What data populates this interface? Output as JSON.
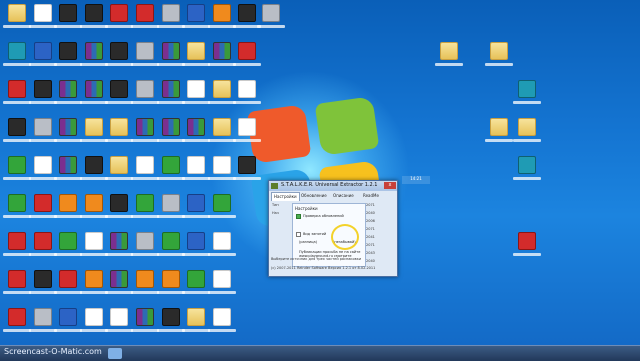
{
  "desktop": {
    "wallpaper": "windows-7-default",
    "accent": "#1474d1",
    "icon_rows": [
      [
        "folder",
        "doc",
        "dark",
        "dark",
        "red",
        "red",
        "grey",
        "blue",
        "orange",
        "dark",
        "grey",
        "",
        "",
        "",
        "",
        "",
        "",
        "",
        "",
        ""
      ],
      [
        "teal",
        "blue",
        "dark",
        "rar",
        "dark",
        "grey",
        "rar",
        "folder",
        "rar",
        "red",
        "",
        "",
        "",
        "",
        "",
        "",
        "folder",
        "folder",
        "",
        ""
      ],
      [
        "red",
        "dark",
        "rar",
        "rar",
        "dark",
        "grey",
        "rar",
        "doc",
        "folder",
        "doc",
        "",
        "",
        "",
        "",
        "",
        "",
        "",
        "",
        "teal",
        ""
      ],
      [
        "dark",
        "grey",
        "rar",
        "folder",
        "folder",
        "rar",
        "rar",
        "rar",
        "folder",
        "doc",
        "",
        "",
        "",
        "",
        "",
        "",
        "",
        "folder",
        "folder",
        ""
      ],
      [
        "green",
        "doc",
        "rar",
        "dark",
        "folder",
        "doc",
        "green",
        "doc",
        "doc",
        "dark",
        "",
        "",
        "",
        "",
        "",
        "",
        "",
        "",
        "teal",
        ""
      ],
      [
        "green",
        "red",
        "orange",
        "orange",
        "dark",
        "green",
        "grey",
        "blue",
        "green",
        "",
        "",
        "",
        "",
        "",
        "",
        "",
        "",
        "",
        "",
        ""
      ],
      [
        "red",
        "red",
        "green",
        "doc",
        "rar",
        "grey",
        "green",
        "blue",
        "doc",
        "",
        "",
        "",
        "",
        "",
        "",
        "",
        "",
        "",
        "red",
        ""
      ],
      [
        "red",
        "dark",
        "red",
        "orange",
        "rar",
        "orange",
        "orange",
        "green",
        "doc",
        "",
        "",
        "",
        "",
        "",
        "",
        "",
        "",
        "",
        "",
        ""
      ],
      [
        "red",
        "grey",
        "blue",
        "doc",
        "doc",
        "rar",
        "dark",
        "folder",
        "doc",
        "",
        "",
        "",
        "",
        "",
        "",
        "",
        "",
        "",
        "",
        ""
      ]
    ]
  },
  "dialog": {
    "title": "S.T.A.L.K.E.R. Universal Extractor 1.2.1",
    "close_label": "x",
    "tabs": [
      "Настройки",
      "Обновление",
      "Описание",
      "ReadMe"
    ],
    "left_labels": [
      "Тип",
      "Нач",
      "",
      "",
      "",
      "",
      "",
      ""
    ],
    "right_values": [
      "2071",
      "2040",
      "2006",
      "2071",
      "2041",
      "2071",
      "2043",
      "2040"
    ],
    "settings_header": "Настройки",
    "checkbox_1": "Проверка обновлений",
    "checkbox_2": "Вид занятий",
    "option_a": "(разница)",
    "option_b": "(незабывай)",
    "link_text": "Публикации просьба не на сайте www.playground.ru смотрите",
    "footer": "(c) 2007-2011 Reinder Software  Версия 1.2.1 от 8.02.2011",
    "warning_line": "Выберите источник для трех частей распаковки"
  },
  "widget": {
    "label": "14:21"
  },
  "taskbar": {
    "watermark": "Screencast-O-Matic.com",
    "items": [
      "start",
      "app",
      "app",
      "app",
      "app"
    ]
  }
}
